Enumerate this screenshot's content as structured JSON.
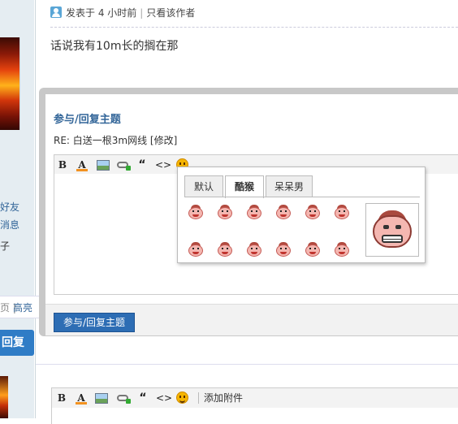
{
  "post": {
    "meta_time": "发表于 4 小时前",
    "meta_author_only": "只看该作者",
    "body": "话说我有10m长的搁在那"
  },
  "left_panel": {
    "link_friend": "好友",
    "link_message": "消息",
    "text_item": "子",
    "highlight": "高亮",
    "reply_button": "回复"
  },
  "reply_modal": {
    "title": "参与/回复主题",
    "subject": "RE: 白送一根3m网线 [修改]",
    "submit": "参与/回复主题"
  },
  "toolbar": {
    "bold": "B",
    "font_color": "A",
    "quote": "“",
    "code": "<>"
  },
  "smiley_popup": {
    "tabs": [
      "默认",
      "酷猴",
      "呆呆男"
    ],
    "active_tab": "酷猴"
  },
  "bottom_editor": {
    "attach": "添加附件"
  },
  "colors": {
    "accent": "#336699",
    "button": "#2d6db4",
    "modal_border": "#c8c8c8"
  }
}
